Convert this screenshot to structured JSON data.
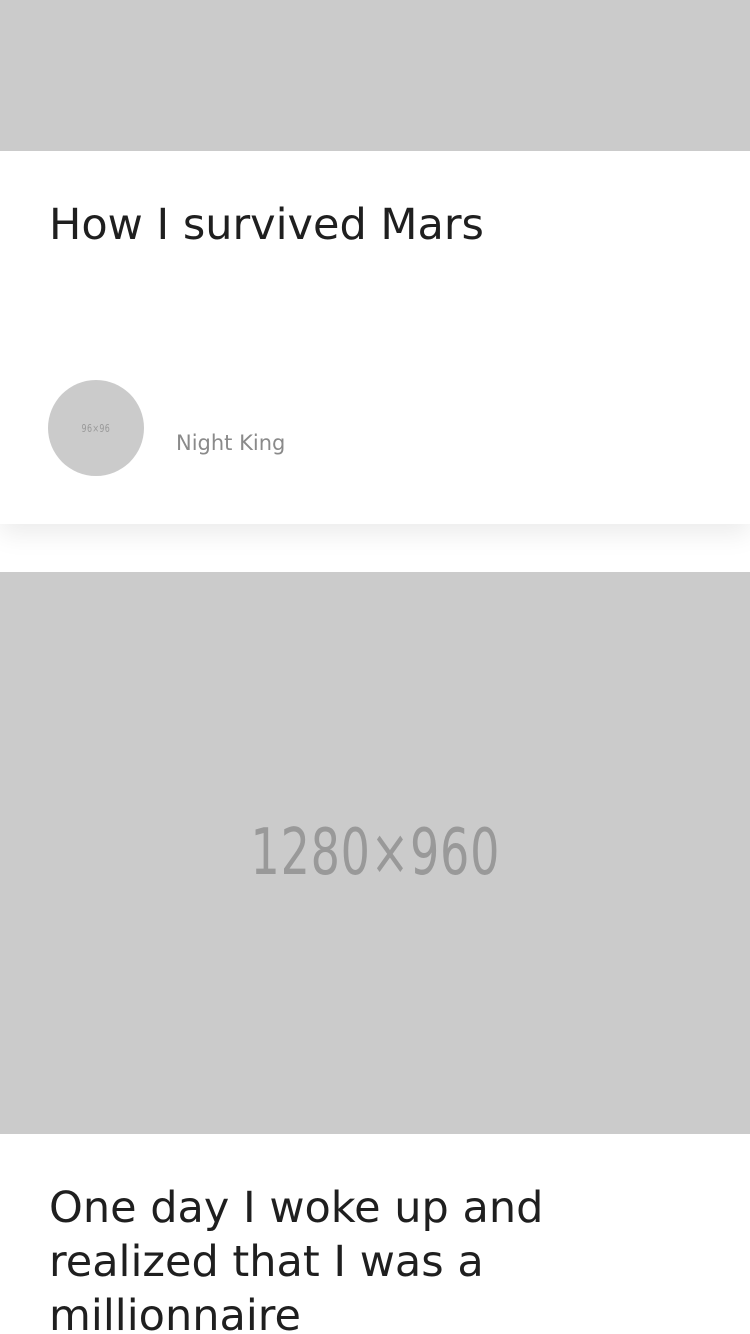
{
  "posts": [
    {
      "cover_label": "",
      "title": "How I survived Mars",
      "avatar_label": "96×96",
      "author": "Night King"
    },
    {
      "cover_label": "1280×960",
      "title": "One day I woke up and realized that I was a millionnaire"
    }
  ],
  "colors": {
    "placeholder_bg": "#cbcbcb",
    "placeholder_text": "#999999",
    "title_text": "#1f1f1f",
    "author_text": "#8a8a8a"
  }
}
